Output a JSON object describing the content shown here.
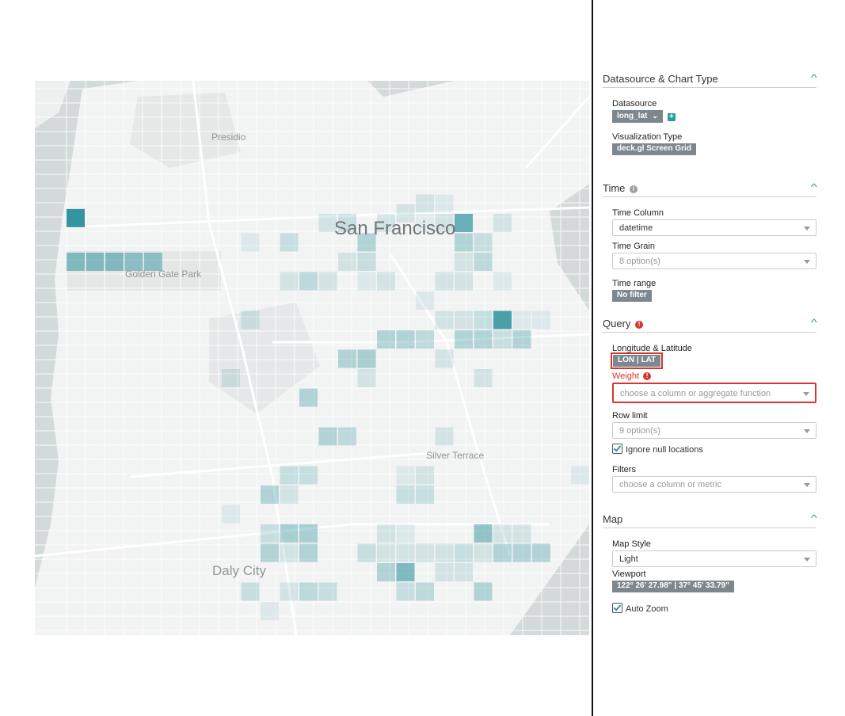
{
  "map": {
    "city_label": "San Francisco",
    "places": [
      "Presidio",
      "Golden Gate Park",
      "Silver Terrace",
      "Daly City"
    ],
    "cell_color": "#1f8a96"
  },
  "panel": {
    "datasource_section": {
      "title": "Datasource & Chart Type",
      "datasource_label": "Datasource",
      "datasource_value": "long_lat",
      "viz_type_label": "Visualization Type",
      "viz_type_value": "deck.gl Screen Grid"
    },
    "time_section": {
      "title": "Time",
      "time_column_label": "Time Column",
      "time_column_value": "datetime",
      "time_grain_label": "Time Grain",
      "time_grain_placeholder": "8 option(s)",
      "time_range_label": "Time range",
      "time_range_value": "No filter"
    },
    "query_section": {
      "title": "Query",
      "lonlat_label": "Longitude & Latitude",
      "lonlat_value": "LON | LAT",
      "weight_label": "Weight",
      "weight_placeholder": "choose a column or aggregate function",
      "row_limit_label": "Row limit",
      "row_limit_placeholder": "9 option(s)",
      "ignore_null_label": "Ignore null locations",
      "filters_label": "Filters",
      "filters_placeholder": "choose a column or metric"
    },
    "map_section": {
      "title": "Map",
      "map_style_label": "Map Style",
      "map_style_value": "Light",
      "viewport_label": "Viewport",
      "viewport_value": "122° 26' 27.98\" | 37° 45' 33.79\"",
      "auto_zoom_label": "Auto Zoom"
    }
  }
}
